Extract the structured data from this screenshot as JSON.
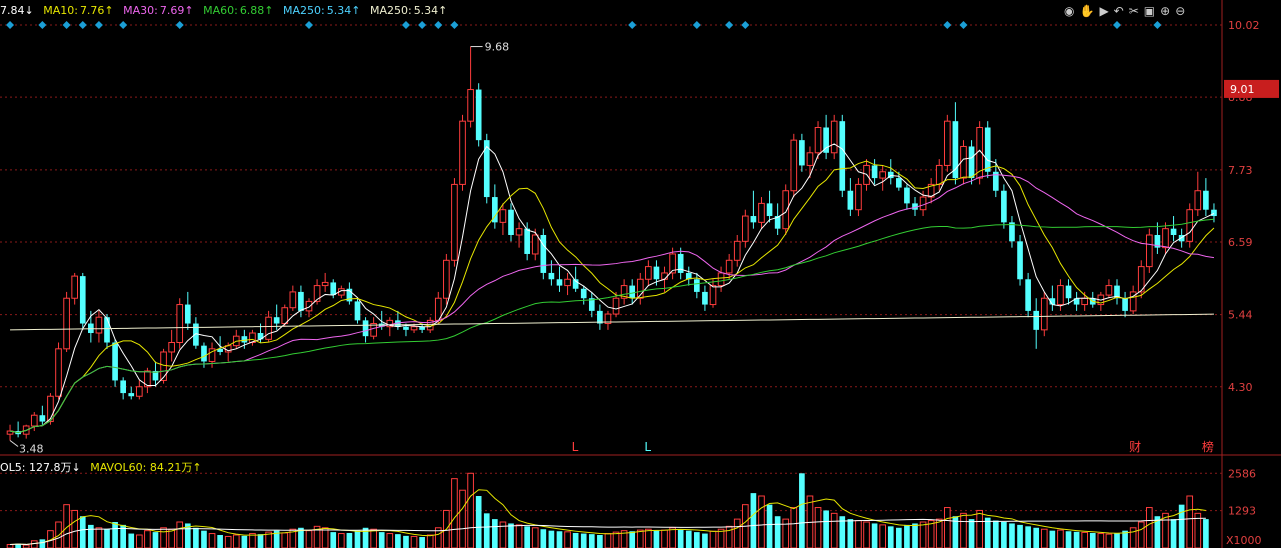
{
  "legend": {
    "ma5": "7.84↓",
    "ma10_label": "MA10:",
    "ma10": "7.76↑",
    "ma30_label": "MA30:",
    "ma30": "7.69↑",
    "ma60_label": "MA60:",
    "ma60": "6.88↑",
    "ma250_label": "MA250:",
    "ma250": "5.34↑",
    "ma250b_label": "MA250:",
    "ma250b": "5.34↑"
  },
  "vol_legend": {
    "vol5": "OL5: 127.8万↓",
    "mavol60": "MAVOL60: 84.21万↑"
  },
  "toolbar_icons": [
    "eye-icon",
    "hand-icon",
    "play-icon",
    "undo-icon",
    "scissors-icon",
    "crop-icon",
    "zoom-in-icon",
    "zoom-out-icon"
  ],
  "colors": {
    "up": "#ff3d3d",
    "down": "#54ffff",
    "ma5": "#ffffff",
    "ma10": "#e6e600",
    "ma30": "#ee66ee",
    "ma60": "#33cc33",
    "ma250": "#f0f0d0",
    "grid": "#8a1a1a",
    "price_box": "#c81e1e",
    "signal": "#1b9fd6"
  },
  "chart_data": {
    "type": "candlestick",
    "price_axis": {
      "min": 3.3,
      "max": 10.1,
      "ticks": [
        "10.02",
        "8.88",
        "7.73",
        "6.59",
        "5.44",
        "4.30"
      ],
      "current_label": "9.01"
    },
    "volume_axis": {
      "ticks": [
        "2586",
        "1293"
      ],
      "unit": "X1000"
    },
    "annotations": {
      "high": "9.68",
      "low": "3.48",
      "markers": [
        "L",
        "L",
        "财",
        "榜"
      ]
    },
    "candles": [
      [
        3.55,
        3.7,
        3.45,
        3.6
      ],
      [
        3.6,
        3.75,
        3.5,
        3.55
      ],
      [
        3.55,
        3.7,
        3.48,
        3.68
      ],
      [
        3.68,
        3.9,
        3.6,
        3.85
      ],
      [
        3.85,
        4.0,
        3.7,
        3.75
      ],
      [
        3.75,
        4.2,
        3.7,
        4.15
      ],
      [
        4.15,
        5.0,
        4.1,
        4.9
      ],
      [
        4.9,
        5.8,
        4.85,
        5.7
      ],
      [
        5.7,
        6.1,
        5.6,
        6.05
      ],
      [
        6.05,
        6.1,
        5.2,
        5.3
      ],
      [
        5.3,
        5.5,
        5.0,
        5.15
      ],
      [
        5.15,
        5.5,
        5.0,
        5.4
      ],
      [
        5.4,
        5.45,
        4.9,
        5.0
      ],
      [
        5.0,
        5.05,
        4.3,
        4.4
      ],
      [
        4.4,
        4.45,
        4.1,
        4.2
      ],
      [
        4.2,
        4.3,
        4.1,
        4.15
      ],
      [
        4.15,
        4.4,
        4.1,
        4.3
      ],
      [
        4.3,
        4.6,
        4.2,
        4.55
      ],
      [
        4.55,
        4.7,
        4.3,
        4.4
      ],
      [
        4.4,
        4.9,
        4.35,
        4.85
      ],
      [
        4.85,
        5.2,
        4.7,
        5.0
      ],
      [
        5.0,
        5.7,
        4.9,
        5.6
      ],
      [
        5.6,
        5.8,
        5.2,
        5.3
      ],
      [
        5.3,
        5.4,
        4.9,
        4.95
      ],
      [
        4.95,
        5.0,
        4.6,
        4.7
      ],
      [
        4.7,
        5.0,
        4.6,
        4.9
      ],
      [
        4.9,
        5.1,
        4.8,
        4.85
      ],
      [
        4.85,
        5.0,
        4.7,
        4.95
      ],
      [
        4.95,
        5.2,
        4.9,
        5.1
      ],
      [
        5.1,
        5.2,
        4.9,
        5.0
      ],
      [
        5.0,
        5.2,
        4.95,
        5.15
      ],
      [
        5.15,
        5.3,
        5.0,
        5.05
      ],
      [
        5.05,
        5.5,
        5.0,
        5.4
      ],
      [
        5.4,
        5.6,
        5.2,
        5.3
      ],
      [
        5.3,
        5.6,
        5.25,
        5.55
      ],
      [
        5.55,
        5.9,
        5.5,
        5.8
      ],
      [
        5.8,
        5.9,
        5.4,
        5.5
      ],
      [
        5.5,
        5.7,
        5.4,
        5.65
      ],
      [
        5.65,
        6.0,
        5.6,
        5.9
      ],
      [
        5.9,
        6.1,
        5.8,
        5.95
      ],
      [
        5.95,
        6.0,
        5.7,
        5.75
      ],
      [
        5.75,
        5.9,
        5.7,
        5.85
      ],
      [
        5.85,
        5.95,
        5.6,
        5.65
      ],
      [
        5.65,
        5.7,
        5.3,
        5.35
      ],
      [
        5.35,
        5.4,
        5.0,
        5.1
      ],
      [
        5.1,
        5.4,
        5.05,
        5.3
      ],
      [
        5.3,
        5.5,
        5.2,
        5.25
      ],
      [
        5.25,
        5.4,
        5.1,
        5.35
      ],
      [
        5.35,
        5.5,
        5.2,
        5.25
      ],
      [
        5.25,
        5.3,
        5.1,
        5.2
      ],
      [
        5.2,
        5.3,
        5.15,
        5.25
      ],
      [
        5.25,
        5.3,
        5.15,
        5.2
      ],
      [
        5.2,
        5.4,
        5.15,
        5.35
      ],
      [
        5.35,
        5.8,
        5.3,
        5.7
      ],
      [
        5.7,
        6.4,
        5.6,
        6.3
      ],
      [
        6.3,
        7.6,
        6.2,
        7.5
      ],
      [
        7.5,
        8.6,
        7.4,
        8.5
      ],
      [
        8.5,
        9.68,
        8.4,
        9.0
      ],
      [
        9.0,
        9.1,
        8.1,
        8.2
      ],
      [
        8.2,
        8.3,
        7.2,
        7.3
      ],
      [
        7.3,
        7.5,
        6.8,
        6.9
      ],
      [
        6.9,
        7.2,
        6.7,
        7.1
      ],
      [
        7.1,
        7.2,
        6.6,
        6.7
      ],
      [
        6.7,
        6.9,
        6.5,
        6.8
      ],
      [
        6.8,
        6.9,
        6.3,
        6.4
      ],
      [
        6.4,
        6.8,
        6.3,
        6.7
      ],
      [
        6.7,
        6.8,
        6.0,
        6.1
      ],
      [
        6.1,
        6.3,
        5.9,
        6.0
      ],
      [
        6.0,
        6.2,
        5.8,
        5.9
      ],
      [
        5.9,
        6.1,
        5.75,
        6.0
      ],
      [
        6.0,
        6.2,
        5.8,
        5.85
      ],
      [
        5.85,
        5.9,
        5.6,
        5.7
      ],
      [
        5.7,
        5.8,
        5.4,
        5.5
      ],
      [
        5.5,
        5.6,
        5.2,
        5.3
      ],
      [
        5.3,
        5.5,
        5.2,
        5.45
      ],
      [
        5.45,
        5.8,
        5.4,
        5.7
      ],
      [
        5.7,
        6.0,
        5.6,
        5.9
      ],
      [
        5.9,
        6.0,
        5.6,
        5.7
      ],
      [
        5.7,
        6.1,
        5.6,
        6.0
      ],
      [
        6.0,
        6.3,
        5.9,
        6.2
      ],
      [
        6.2,
        6.3,
        5.9,
        6.0
      ],
      [
        6.0,
        6.2,
        5.8,
        6.1
      ],
      [
        6.1,
        6.5,
        6.0,
        6.4
      ],
      [
        6.4,
        6.5,
        6.0,
        6.1
      ],
      [
        6.1,
        6.2,
        5.9,
        6.0
      ],
      [
        6.0,
        6.1,
        5.7,
        5.8
      ],
      [
        5.8,
        5.9,
        5.5,
        5.6
      ],
      [
        5.6,
        6.0,
        5.55,
        5.9
      ],
      [
        5.9,
        6.2,
        5.8,
        6.1
      ],
      [
        6.1,
        6.4,
        6.0,
        6.3
      ],
      [
        6.3,
        6.7,
        6.2,
        6.6
      ],
      [
        6.6,
        7.1,
        6.5,
        7.0
      ],
      [
        7.0,
        7.4,
        6.8,
        6.9
      ],
      [
        6.9,
        7.3,
        6.8,
        7.2
      ],
      [
        7.2,
        7.4,
        6.9,
        7.0
      ],
      [
        7.0,
        7.2,
        6.7,
        6.8
      ],
      [
        6.8,
        7.5,
        6.7,
        7.4
      ],
      [
        7.4,
        8.3,
        7.3,
        8.2
      ],
      [
        8.2,
        8.3,
        7.7,
        7.8
      ],
      [
        7.8,
        8.1,
        7.6,
        8.0
      ],
      [
        8.0,
        8.5,
        7.9,
        8.4
      ],
      [
        8.4,
        8.6,
        7.9,
        8.0
      ],
      [
        8.0,
        8.6,
        7.9,
        8.5
      ],
      [
        8.5,
        8.6,
        7.3,
        7.4
      ],
      [
        7.4,
        7.6,
        7.0,
        7.1
      ],
      [
        7.1,
        7.6,
        7.0,
        7.5
      ],
      [
        7.5,
        7.9,
        7.4,
        7.8
      ],
      [
        7.8,
        7.9,
        7.5,
        7.6
      ],
      [
        7.6,
        7.8,
        7.4,
        7.7
      ],
      [
        7.7,
        7.9,
        7.5,
        7.6
      ],
      [
        7.6,
        7.7,
        7.4,
        7.45
      ],
      [
        7.45,
        7.5,
        7.1,
        7.2
      ],
      [
        7.2,
        7.3,
        7.0,
        7.1
      ],
      [
        7.1,
        7.4,
        7.0,
        7.3
      ],
      [
        7.3,
        7.6,
        7.2,
        7.5
      ],
      [
        7.5,
        7.9,
        7.4,
        7.8
      ],
      [
        7.8,
        8.6,
        7.7,
        8.5
      ],
      [
        8.5,
        8.8,
        7.5,
        7.6
      ],
      [
        7.6,
        8.2,
        7.5,
        8.1
      ],
      [
        8.1,
        8.2,
        7.5,
        7.6
      ],
      [
        7.6,
        8.5,
        7.5,
        8.4
      ],
      [
        8.4,
        8.5,
        7.6,
        7.7
      ],
      [
        7.7,
        7.9,
        7.3,
        7.4
      ],
      [
        7.4,
        7.5,
        6.8,
        6.9
      ],
      [
        6.9,
        7.0,
        6.5,
        6.6
      ],
      [
        6.6,
        6.7,
        5.9,
        6.0
      ],
      [
        6.0,
        6.1,
        5.4,
        5.5
      ],
      [
        5.5,
        5.7,
        4.9,
        5.2
      ],
      [
        5.2,
        5.8,
        5.1,
        5.7
      ],
      [
        5.7,
        5.9,
        5.5,
        5.6
      ],
      [
        5.6,
        6.0,
        5.5,
        5.9
      ],
      [
        5.9,
        6.0,
        5.6,
        5.7
      ],
      [
        5.7,
        5.8,
        5.5,
        5.6
      ],
      [
        5.6,
        5.8,
        5.5,
        5.7
      ],
      [
        5.7,
        5.8,
        5.55,
        5.6
      ],
      [
        5.6,
        5.8,
        5.5,
        5.75
      ],
      [
        5.75,
        6.0,
        5.7,
        5.9
      ],
      [
        5.9,
        6.0,
        5.6,
        5.7
      ],
      [
        5.7,
        5.8,
        5.4,
        5.5
      ],
      [
        5.5,
        5.9,
        5.45,
        5.8
      ],
      [
        5.8,
        6.3,
        5.7,
        6.2
      ],
      [
        6.2,
        6.8,
        6.1,
        6.7
      ],
      [
        6.7,
        6.9,
        6.4,
        6.5
      ],
      [
        6.5,
        6.9,
        6.4,
        6.8
      ],
      [
        6.8,
        7.0,
        6.6,
        6.7
      ],
      [
        6.7,
        6.8,
        6.5,
        6.6
      ],
      [
        6.6,
        7.2,
        6.5,
        7.1
      ],
      [
        7.1,
        7.7,
        7.0,
        7.4
      ],
      [
        7.4,
        7.6,
        7.0,
        7.1
      ],
      [
        7.1,
        7.2,
        6.9,
        7.0
      ]
    ],
    "volume": [
      120,
      150,
      100,
      250,
      300,
      600,
      900,
      1500,
      1300,
      1100,
      800,
      700,
      650,
      900,
      800,
      500,
      450,
      600,
      550,
      700,
      650,
      900,
      850,
      700,
      600,
      500,
      450,
      400,
      450,
      420,
      500,
      480,
      550,
      600,
      520,
      650,
      700,
      600,
      750,
      700,
      550,
      500,
      520,
      600,
      700,
      650,
      550,
      500,
      480,
      420,
      400,
      380,
      450,
      700,
      1300,
      2400,
      2000,
      2586,
      1800,
      1200,
      1000,
      900,
      850,
      800,
      750,
      700,
      650,
      600,
      580,
      560,
      520,
      500,
      480,
      450,
      500,
      550,
      600,
      580,
      620,
      650,
      600,
      620,
      700,
      650,
      600,
      550,
      500,
      580,
      650,
      750,
      1000,
      1500,
      1900,
      1800,
      1500,
      1100,
      1000,
      1400,
      2586,
      1800,
      1400,
      1300,
      1200,
      1100,
      1000,
      950,
      900,
      850,
      800,
      750,
      700,
      800,
      850,
      900,
      950,
      1000,
      1400,
      1100,
      1200,
      1000,
      1300,
      1050,
      950,
      900,
      850,
      800,
      750,
      700,
      650,
      600,
      620,
      580,
      560,
      540,
      520,
      500,
      480,
      520,
      600,
      700,
      900,
      1400,
      1100,
      1200,
      1000,
      1500,
      1800,
      1200,
      1000
    ]
  }
}
